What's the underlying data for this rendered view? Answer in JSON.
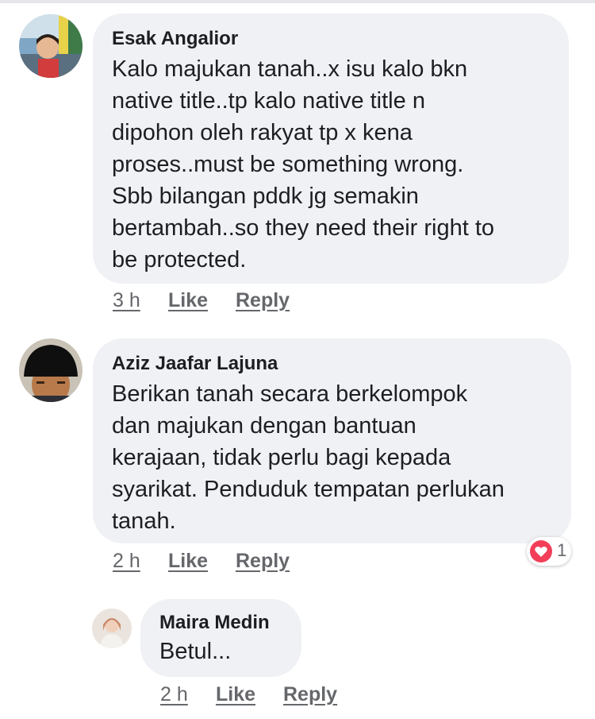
{
  "comments": [
    {
      "author": "Esak Angalior",
      "lines": [
        "Kalo majukan tanah..x isu kalo bkn",
        "native title..tp kalo native title n",
        "dipohon oleh rakyat tp x kena",
        "proses..must be something wrong.",
        "Sbb bilangan pddk jg semakin",
        "bertambah..so they need their right to",
        "be protected."
      ],
      "time": "3 h",
      "like": "Like",
      "reply": "Reply"
    },
    {
      "author": "Aziz Jaafar Lajuna",
      "lines": [
        "Berikan tanah secara berkelompok",
        "dan majukan dengan bantuan",
        "kerajaan, tidak perlu bagi kepada",
        "syarikat. Penduduk tempatan perlukan",
        "tanah."
      ],
      "time": "2 h",
      "like": "Like",
      "reply": "Reply",
      "reaction": {
        "icon": "heart-icon",
        "count": "1",
        "color": "#f33e58"
      }
    },
    {
      "author": "Maira Medin",
      "lines": [
        "Betul..."
      ],
      "time": "2 h",
      "like": "Like",
      "reply": "Reply"
    }
  ],
  "colors": {
    "bubble": "#f0f1f4",
    "meta_text": "#65676b",
    "text": "#1c1e21"
  }
}
